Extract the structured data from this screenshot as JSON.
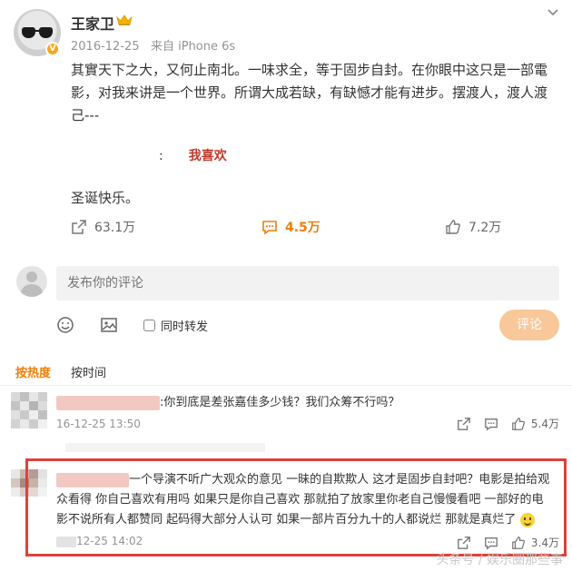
{
  "post": {
    "username": "王家卫",
    "date": "2016-12-25",
    "source": "来自 iPhone 6s",
    "text": "其實天下之大，又何止南北。一味求全，等于固步自封。在你眼中这只是一部電影，对我来讲是一个世界。所谓大成若缺，有缺憾才能有进步。摆渡人，渡人渡己---",
    "video_separator": ":",
    "video_label": "我喜欢",
    "text2": "圣诞快乐。",
    "reposts": "63.1万",
    "comments": "4.5万",
    "likes": "7.2万",
    "colors": {
      "accent": "#f07f07",
      "highlight_border": "#e0403a"
    }
  },
  "composer": {
    "placeholder": "发布你的评论",
    "repost_checkbox_label": "同时转发",
    "submit_label": "评论"
  },
  "sort": {
    "hot": "按热度",
    "time": "按时间"
  },
  "comments": [
    {
      "separator": ":",
      "text": "你到底是差张嘉佳多少钱？我们众筹不行吗？",
      "time": "16-12-25 13:50",
      "likes": "5.4万"
    },
    {
      "separator": "",
      "text": "一个导演不听广大观众的意见 一昧的自欺欺人 这才是固步自封吧？电影是拍给观众看得 你自己喜欢有用吗 如果只是你自己喜欢 那就拍了放家里你老自己慢慢看吧 一部好的电影不说所有人都赞同 起码得大部分人认可 如果一部片百分九十的人都说烂 那就是真烂了",
      "time": "12-25 14:02",
      "likes": "3.4万"
    }
  ],
  "watermark": "头条号 / 娱乐圈那些事"
}
